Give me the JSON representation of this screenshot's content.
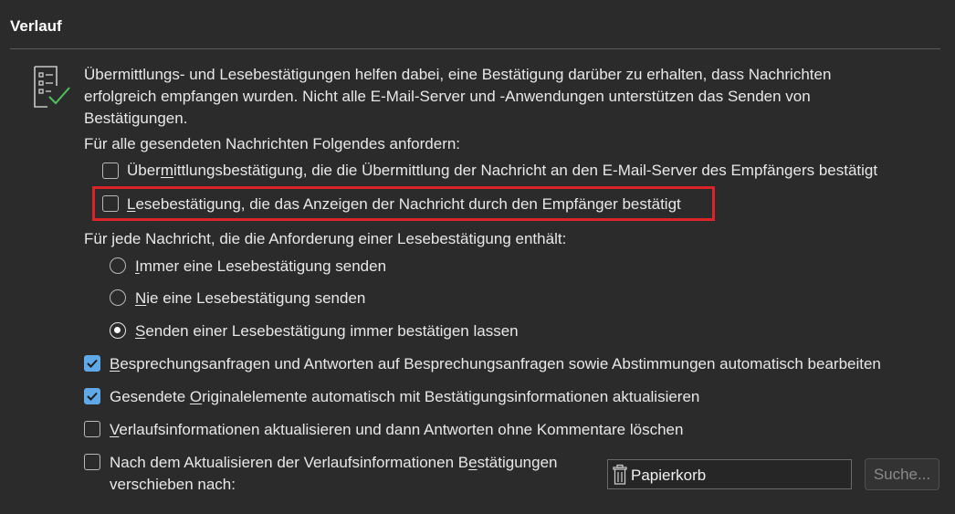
{
  "section": {
    "title": "Verlauf"
  },
  "intro": {
    "line1": "Übermittlungs- und Lesebestätigungen helfen dabei, eine Bestätigung darüber zu erhalten, dass Nachrichten",
    "line2": "erfolgreich empfangen wurden. Nicht alle E-Mail-Server und -Anwendungen unterstützen das Senden von",
    "line3": "Bestätigungen.",
    "icon": "checklist-icon"
  },
  "request": {
    "heading": "Für alle gesendeten Nachrichten Folgendes anfordern:",
    "delivery": {
      "pre": "Über",
      "key": "m",
      "post": "ittlungsbestätigung, die die Übermittlung der Nachricht an den E-Mail-Server des Empfängers bestätigt",
      "checked": false
    },
    "read": {
      "key": "L",
      "post": "esebestätigung, die das Anzeigen der Nachricht durch den Empfänger bestätigt",
      "checked": false
    }
  },
  "response": {
    "heading": "Für jede Nachricht, die die Anforderung einer Lesebestätigung enthält:",
    "always": {
      "key": "I",
      "post": "mmer eine Lesebestätigung senden",
      "selected": false
    },
    "never": {
      "key": "N",
      "post": "ie eine Lesebestätigung senden",
      "selected": false
    },
    "ask": {
      "key": "S",
      "post": "enden einer Lesebestätigung immer bestätigen lassen",
      "selected": true
    }
  },
  "options": {
    "meetings": {
      "key": "B",
      "post": "esprechungsanfragen und Antworten auf Besprechungsanfragen sowie Abstimmungen automatisch bearbeiten",
      "checked": true
    },
    "update_sent": {
      "pre": "Gesendete ",
      "key": "O",
      "post": "riginalelemente automatisch mit Bestätigungsinformationen aktualisieren",
      "checked": true
    },
    "delete_replies": {
      "key": "V",
      "post": "erlaufsinformationen aktualisieren und dann Antworten ohne Kommentare löschen",
      "checked": false
    },
    "move": {
      "line1_pre": "Nach dem Aktualisieren der Verlaufsinformationen B",
      "line1_key": "e",
      "line1_post": "stätigungen",
      "line2": "verschieben nach:",
      "checked": false,
      "folder_icon": "trash-icon",
      "folder_value": "Papierkorb",
      "browse_label": "Suche..."
    }
  },
  "colors": {
    "background": "#2b2b2b",
    "accent": "#60a9e8",
    "highlight": "#d9242c"
  }
}
